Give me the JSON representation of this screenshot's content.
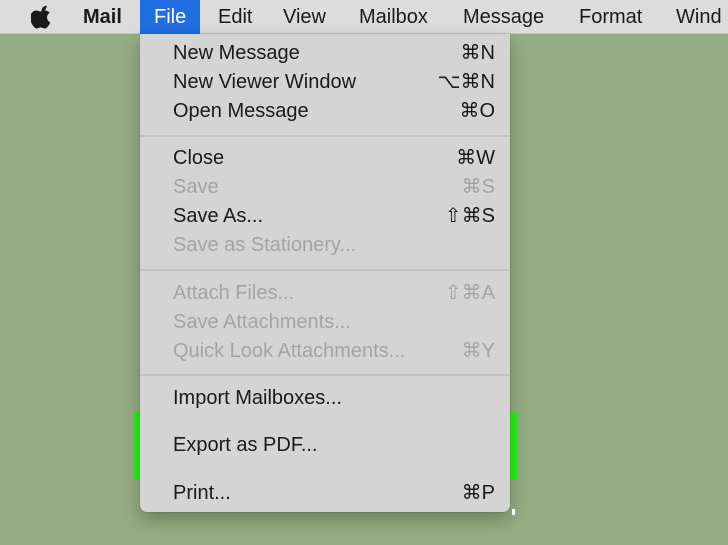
{
  "menubar": {
    "apple_icon": "apple-logo-icon",
    "app_name": "Mail",
    "items": [
      "File",
      "Edit",
      "View",
      "Mailbox",
      "Message",
      "Format",
      "Wind"
    ]
  },
  "file_menu": {
    "items": [
      {
        "label": "New Message",
        "shortcut": "⌘N",
        "enabled": true
      },
      {
        "label": "New Viewer Window",
        "shortcut": "⌥⌘N",
        "enabled": true
      },
      {
        "label": "Open Message",
        "shortcut": "⌘O",
        "enabled": true
      },
      {
        "label": "Close",
        "shortcut": "⌘W",
        "enabled": true
      },
      {
        "label": "Save",
        "shortcut": "⌘S",
        "enabled": false
      },
      {
        "label": "Save As...",
        "shortcut": "⇧⌘S",
        "enabled": true
      },
      {
        "label": "Save as Stationery...",
        "shortcut": "",
        "enabled": false
      },
      {
        "label": "Attach Files...",
        "shortcut": "⇧⌘A",
        "enabled": false
      },
      {
        "label": "Save Attachments...",
        "shortcut": "",
        "enabled": false
      },
      {
        "label": "Quick Look Attachments...",
        "shortcut": "⌘Y",
        "enabled": false
      },
      {
        "label": "Import Mailboxes...",
        "shortcut": "",
        "enabled": true
      },
      {
        "label": "Export as PDF...",
        "shortcut": "",
        "enabled": true,
        "highlighted": true
      },
      {
        "label": "Print...",
        "shortcut": "⌘P",
        "enabled": true
      }
    ]
  },
  "colors": {
    "background": "#96ad84",
    "menubar": "#dcdcdc",
    "selected_menu": "#1f6ee3",
    "dropdown": "#d4d4d4",
    "disabled_text": "#a3a3a3",
    "highlight_border": "#2cf21c",
    "highlight_fill": "#f6f6f6"
  }
}
